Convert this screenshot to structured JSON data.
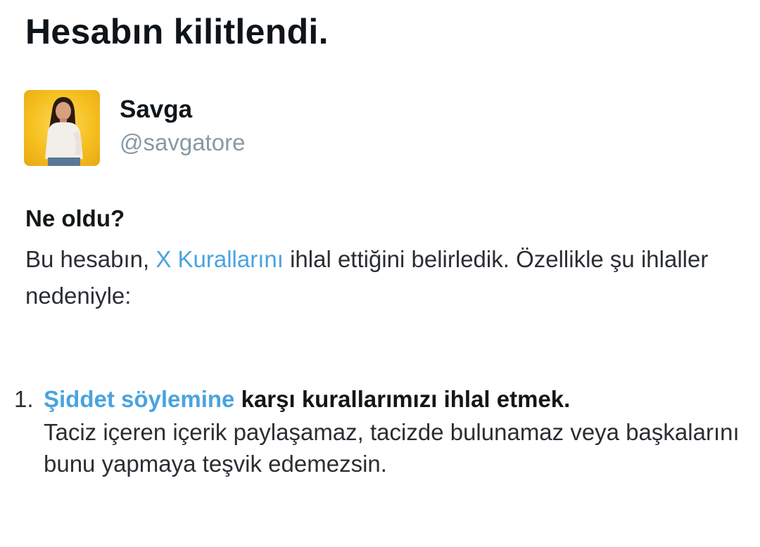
{
  "page": {
    "title": "Hesabın kilitlendi."
  },
  "account": {
    "display_name": "Savga",
    "handle": "@savgatore",
    "avatar_icon": "profile-photo",
    "avatar_bg": "#f5c020"
  },
  "details": {
    "heading": "Ne oldu?",
    "text_before_link": "Bu hesabın, ",
    "rules_link": "X Kurallarını",
    "text_after_link": " ihlal ettiğini belirledik. Özellikle şu ihlaller nedeniyle:"
  },
  "violations": [
    {
      "number": "1.",
      "policy_link": "Şiddet söylemine",
      "title_rest": " karşı kurallarımızı ihlal etmek.",
      "description": "Taciz içeren içerik paylaşamaz, tacizde bulunamaz veya başkalarını bunu yapmaya teşvik edemezsin."
    }
  ],
  "colors": {
    "link": "#4aa3df",
    "text": "#14171a",
    "muted": "#8899a6"
  }
}
